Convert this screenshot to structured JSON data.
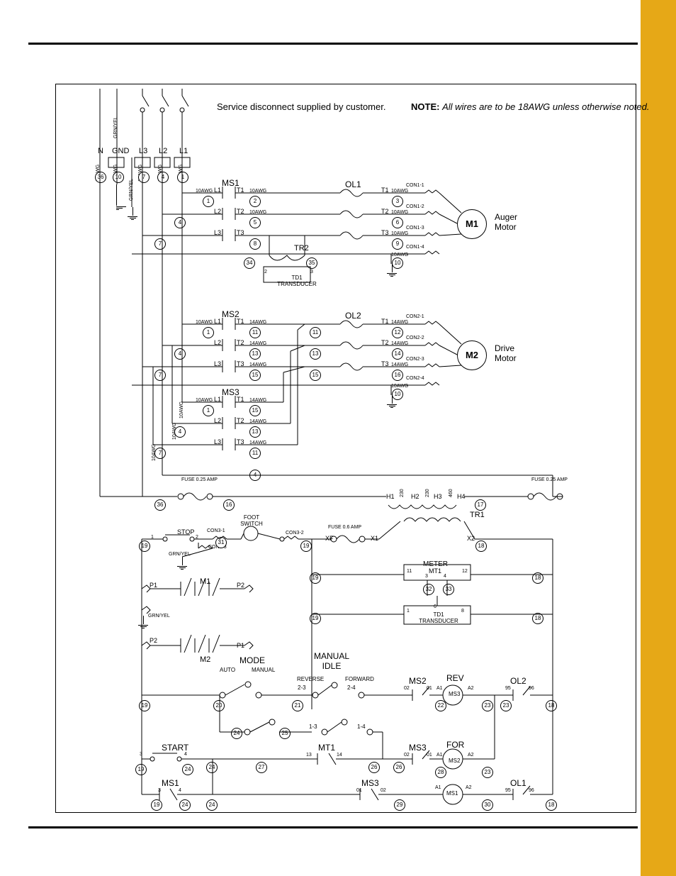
{
  "notes": {
    "service": "Service disconnect supplied\nby customer.",
    "note_label": "NOTE:",
    "note_text": "All wires are to be 18AWG\nunless otherwise noted."
  },
  "power_in": {
    "N": "N",
    "GND": "GND",
    "L3": "L3",
    "L2": "L2",
    "L1": "L1",
    "grnyel1": "GRN/YEL",
    "grnyel2": "GRN/YEL",
    "awg10": "10AWG",
    "awg18": "18AWG"
  },
  "motors": {
    "m1_id": "M1",
    "m1_label": "Auger\nMotor",
    "m2_id": "M2",
    "m2_label": "Drive\nMotor"
  },
  "starters": {
    "ms1": "MS1",
    "ms2": "MS2",
    "ms3": "MS3",
    "ol1": "OL1",
    "ol2": "OL2",
    "l1": "L1",
    "l2": "L2",
    "l3": "L3",
    "t1": "T1",
    "t2": "T2",
    "t3": "T3"
  },
  "transformers": {
    "tr1": "TR1",
    "tr2": "TR2",
    "td1": "TD1\nTRANSDUCER",
    "td1b": "TD1\nTRANSDUCER",
    "h1": "H1",
    "h2": "H2",
    "h3": "H3",
    "h4": "H4",
    "x1": "X1",
    "x2": "X2",
    "xf": "XF"
  },
  "fuses": {
    "f025a": "FUSE 0.25 AMP",
    "f025b": "FUSE 0.25 AMP",
    "f06": "FUSE 0.6 AMP"
  },
  "controls": {
    "stop": "STOP",
    "foot": "FOOT\nSWITCH",
    "meter": "METER",
    "mt1": "MT1",
    "m1": "M1",
    "m2": "M2",
    "p1": "P1",
    "p2": "P2",
    "mode": "MODE",
    "auto": "AUTO",
    "manual": "MANUAL",
    "manidle": "MANUAL\nIDLE",
    "reverse": "REVERSE",
    "forward": "FORWARD",
    "start": "START",
    "rev": "REV",
    "for": "FOR",
    "ms1c": "MS1",
    "ms2c": "MS2",
    "ms3c": "MS3",
    "a1": "A1",
    "a2": "A2",
    "grnyel": "GRN/YEL"
  },
  "conns": {
    "con11": "CON1-1",
    "con12": "CON1-2",
    "con13": "CON1-3",
    "con14": "CON1-4",
    "con21": "CON2-1",
    "con22": "CON2-2",
    "con23": "CON2-3",
    "con24": "CON2-4",
    "con31": "CON3-1",
    "con32": "CON3-2",
    "con33": "CON3-3"
  },
  "awg": {
    "a10": "10AWG",
    "a14": "14AWG"
  },
  "sw_terms": {
    "s23": "2-3",
    "s24": "2-4",
    "s13": "1-3",
    "s14": "1-4"
  },
  "contact_nums": {
    "ms1_34": "3",
    "ms1_4": "4",
    "mt1_1314": "13",
    "mt1_14": "14",
    "ms3_0102": "01",
    "ms3_02": "02",
    "ms2_0201": "02",
    "ms2_01": "01",
    "ol_9596": "95",
    "ol_96": "96",
    "mt1_1112": "11",
    "mt1_12": "12",
    "mt1_34": "3",
    "mt1_4": "4",
    "td_168": "1",
    "td_6": "6",
    "td_8": "8",
    "xfmr_230": "230",
    "xfmr_460": "460"
  },
  "wire_numbers": [
    "36",
    "10",
    "7",
    "4",
    "1",
    "1",
    "2",
    "3",
    "4",
    "5",
    "6",
    "7",
    "8",
    "9",
    "10",
    "34",
    "35",
    "11",
    "11",
    "12",
    "13",
    "13",
    "14",
    "15",
    "15",
    "16",
    "10",
    "15",
    "13",
    "11",
    "4",
    "16",
    "17",
    "36",
    "19",
    "31",
    "19",
    "18",
    "19",
    "32",
    "33",
    "18",
    "19",
    "18",
    "19",
    "18",
    "20",
    "21",
    "22",
    "23",
    "23",
    "18",
    "24",
    "25",
    "26",
    "27",
    "24",
    "24",
    "19",
    "19",
    "24",
    "26",
    "26",
    "28",
    "29",
    "30",
    "18",
    "24"
  ]
}
